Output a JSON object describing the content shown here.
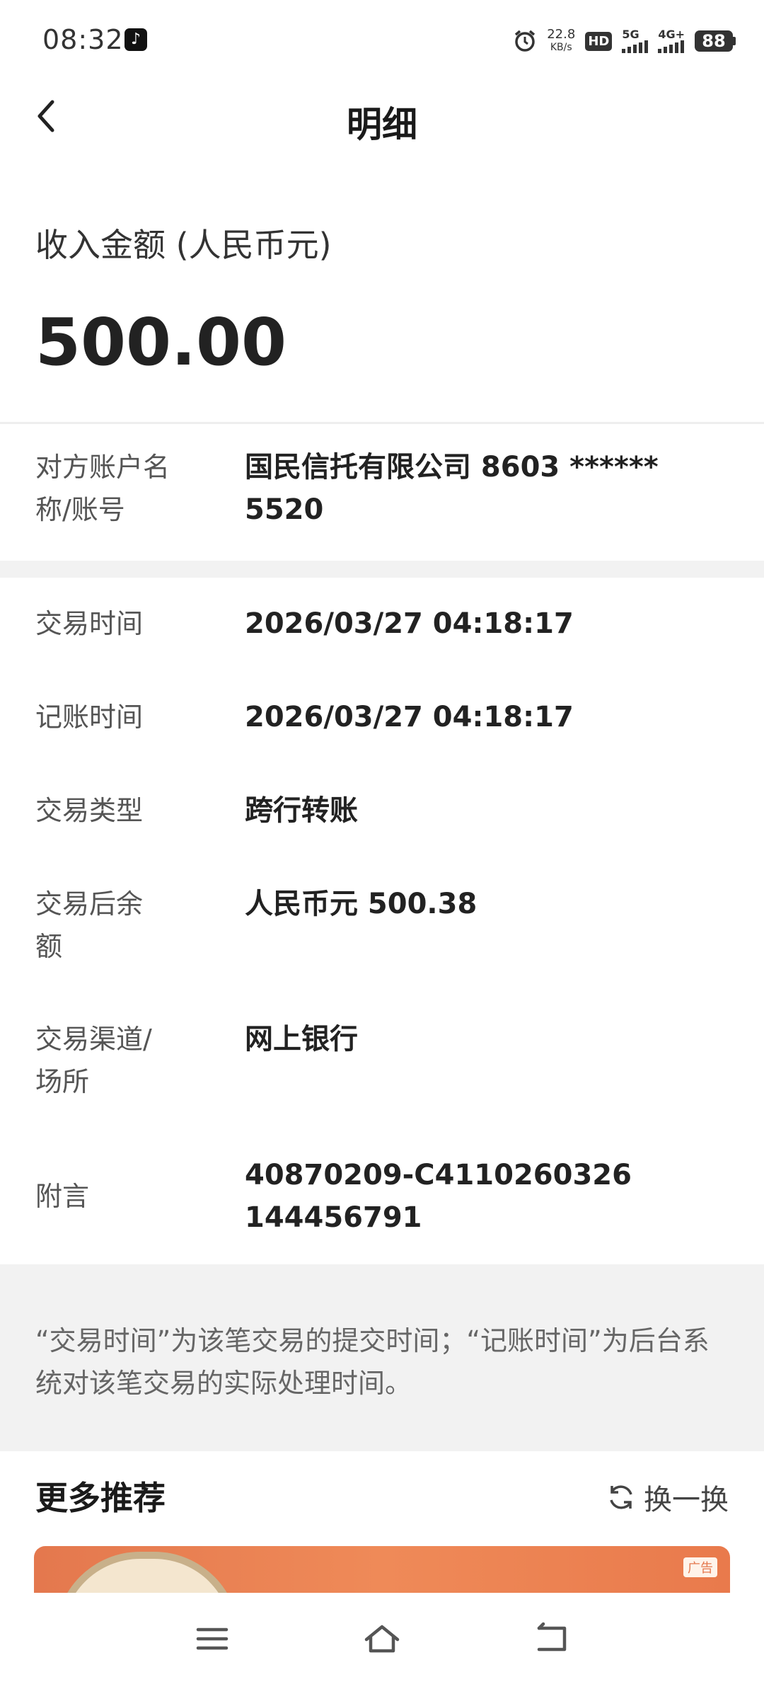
{
  "status_bar": {
    "time": "08:32",
    "net_speed_value": "22.8",
    "net_speed_unit": "KB/s",
    "hd_label": "HD",
    "signal1_label": "5G",
    "signal2_label": "4G+",
    "battery": "88"
  },
  "header": {
    "title": "明细"
  },
  "amount": {
    "label": "收入金额 (人民币元)",
    "value": "500.00"
  },
  "account": {
    "label": "对方账户名称/账号",
    "value": "国民信托有限公司 8603 ****** 5520"
  },
  "details": [
    {
      "label": "交易时间",
      "value": "2026/03/27 04:18:17"
    },
    {
      "label": "记账时间",
      "value": "2026/03/27 04:18:17"
    },
    {
      "label": "交易类型",
      "value": "跨行转账"
    },
    {
      "label": "交易后余额",
      "value": "人民币元 500.38"
    },
    {
      "label": "交易渠道/场所",
      "value": "网上银行"
    },
    {
      "label": "附言",
      "value": "40870209-C4110260326144456791"
    }
  ],
  "note": "“交易时间”为该笔交易的提交时间；“记账时间”为后台系统对该笔交易的实际处理时间。",
  "recommend": {
    "title": "更多推荐",
    "refresh_label": "换一换",
    "ad_tag": "广告"
  }
}
